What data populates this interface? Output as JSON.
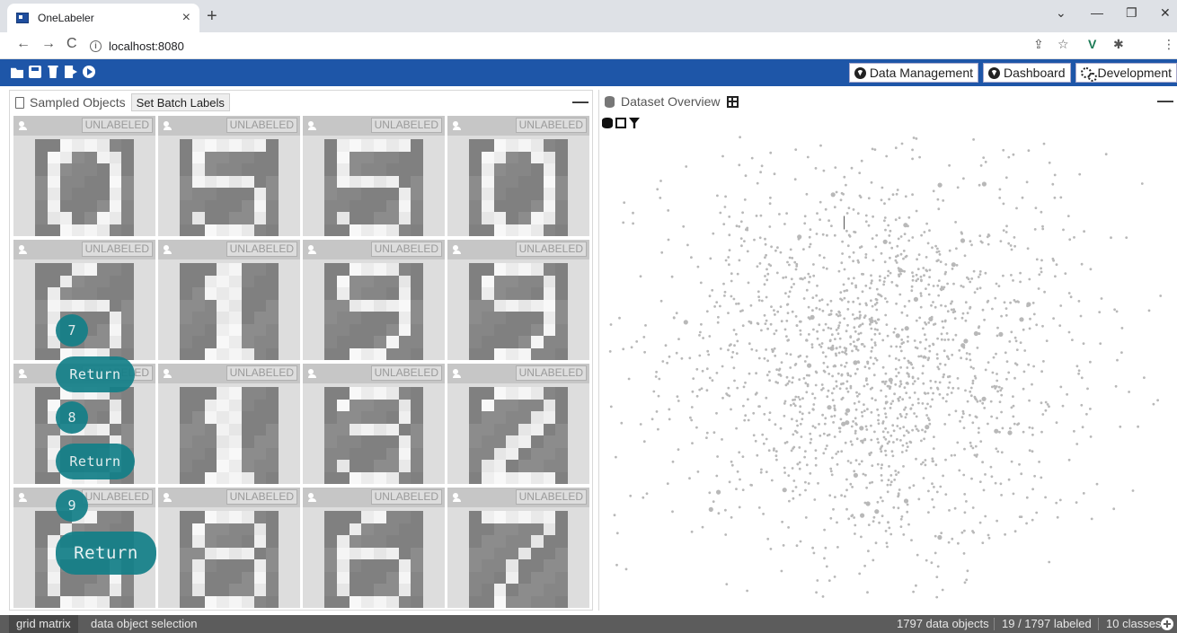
{
  "browser": {
    "tab_title": "OneLabeler",
    "tab_close": "×",
    "new_tab": "+",
    "back": "←",
    "forward": "→",
    "reload": "C",
    "url": "localhost:8080",
    "minimize": "⌄",
    "win_min": "—",
    "win_restore": "❐",
    "win_close": "✕",
    "ext_share": "⇪",
    "ext_star": "☆",
    "ext_vue": "V",
    "ext_puzzle": "✱",
    "menu": "⋮"
  },
  "toolbar": {
    "icons": [
      "folder-open-icon",
      "save-icon",
      "trash-icon",
      "export-icon",
      "play-icon"
    ],
    "data_management": "Data Management",
    "dashboard": "Dashboard",
    "development": "Development"
  },
  "left_panel": {
    "title": "Sampled Objects",
    "batch_button": "Set Batch Labels",
    "minimize": "—",
    "cells": [
      {
        "status": "UNLABELED",
        "digit": "0"
      },
      {
        "status": "UNLABELED",
        "digit": "5"
      },
      {
        "status": "UNLABELED",
        "digit": "5"
      },
      {
        "status": "UNLABELED",
        "digit": "0"
      },
      {
        "status": "UNLABELED",
        "digit": "6"
      },
      {
        "status": "UNLABELED",
        "digit": "1"
      },
      {
        "status": "UNLABELED",
        "digit": "9"
      },
      {
        "status": "UNLABELED",
        "digit": "9"
      },
      {
        "status": "UNLABELED",
        "digit": "8"
      },
      {
        "status": "UNLABELED",
        "digit": "1"
      },
      {
        "status": "UNLABELED",
        "digit": "3"
      },
      {
        "status": "UNLABELED",
        "digit": "2"
      },
      {
        "status": "UNLABELED",
        "digit": "6"
      },
      {
        "status": "UNLABELED",
        "digit": "8"
      },
      {
        "status": "UNLABELED",
        "digit": "6"
      },
      {
        "status": "UNLABELED",
        "digit": "7"
      }
    ]
  },
  "overlay": {
    "hints": [
      {
        "number": "7",
        "return_label": "Return"
      },
      {
        "number": "8",
        "return_label": "Return"
      },
      {
        "number": "9",
        "return_label": "Return"
      }
    ]
  },
  "right_panel": {
    "title": "Dataset Overview",
    "minimize": "—",
    "sub_icons": [
      "database-icon",
      "table-icon",
      "filter-icon"
    ],
    "point_color": "#b8b8b8"
  },
  "statusbar": {
    "tabs": [
      "grid matrix",
      "data object selection"
    ],
    "data_objects": "1797 data objects",
    "labeled": "19 / 1797 labeled",
    "classes": "10 classes"
  },
  "colors": {
    "toolbar": "#1e56a8",
    "overlay": "#137f88",
    "status_bar": "#5c5c5c"
  }
}
